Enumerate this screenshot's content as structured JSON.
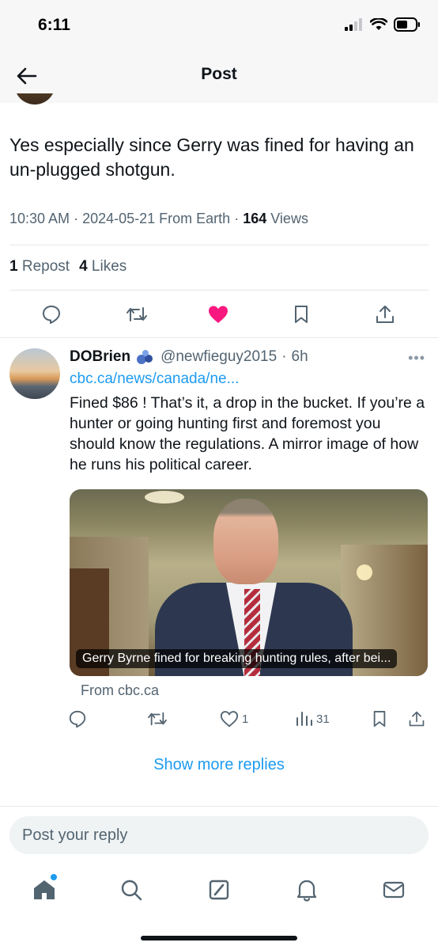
{
  "status_bar": {
    "time": "6:11"
  },
  "header": {
    "title": "Post"
  },
  "post": {
    "text": "Yes especially since Gerry was fined for having an un-plugged shotgun.",
    "time": "10:30 AM",
    "date": "2024-05-21",
    "source": "From Earth",
    "views_count": "164",
    "views_label": "Views",
    "reposts_count": "1",
    "reposts_label": "Repost",
    "likes_count": "4",
    "likes_label": "Likes",
    "liked": true,
    "like_color": "#f91880"
  },
  "reply": {
    "name": "DOBrien",
    "handle": "@newfieguy2015",
    "age": "6h",
    "link": "cbc.ca/news/canada/ne...",
    "text": "Fined $86 ! That’s it, a drop in the bucket. If you’re a hunter or going hunting first and foremost you should know the regulations.  A mirror image of how he runs his political career.",
    "card_caption": "Gerry Byrne fined for breaking hunting rules, after bei...",
    "card_source": "From cbc.ca",
    "likes_count": "1",
    "views_count": "31"
  },
  "show_more": "Show more replies",
  "reply_input": {
    "placeholder": "Post your reply"
  },
  "tabs": [
    "home-icon",
    "search-icon",
    "grok-icon",
    "notifications-icon",
    "messages-icon"
  ],
  "accent_color": "#1d9bf0"
}
